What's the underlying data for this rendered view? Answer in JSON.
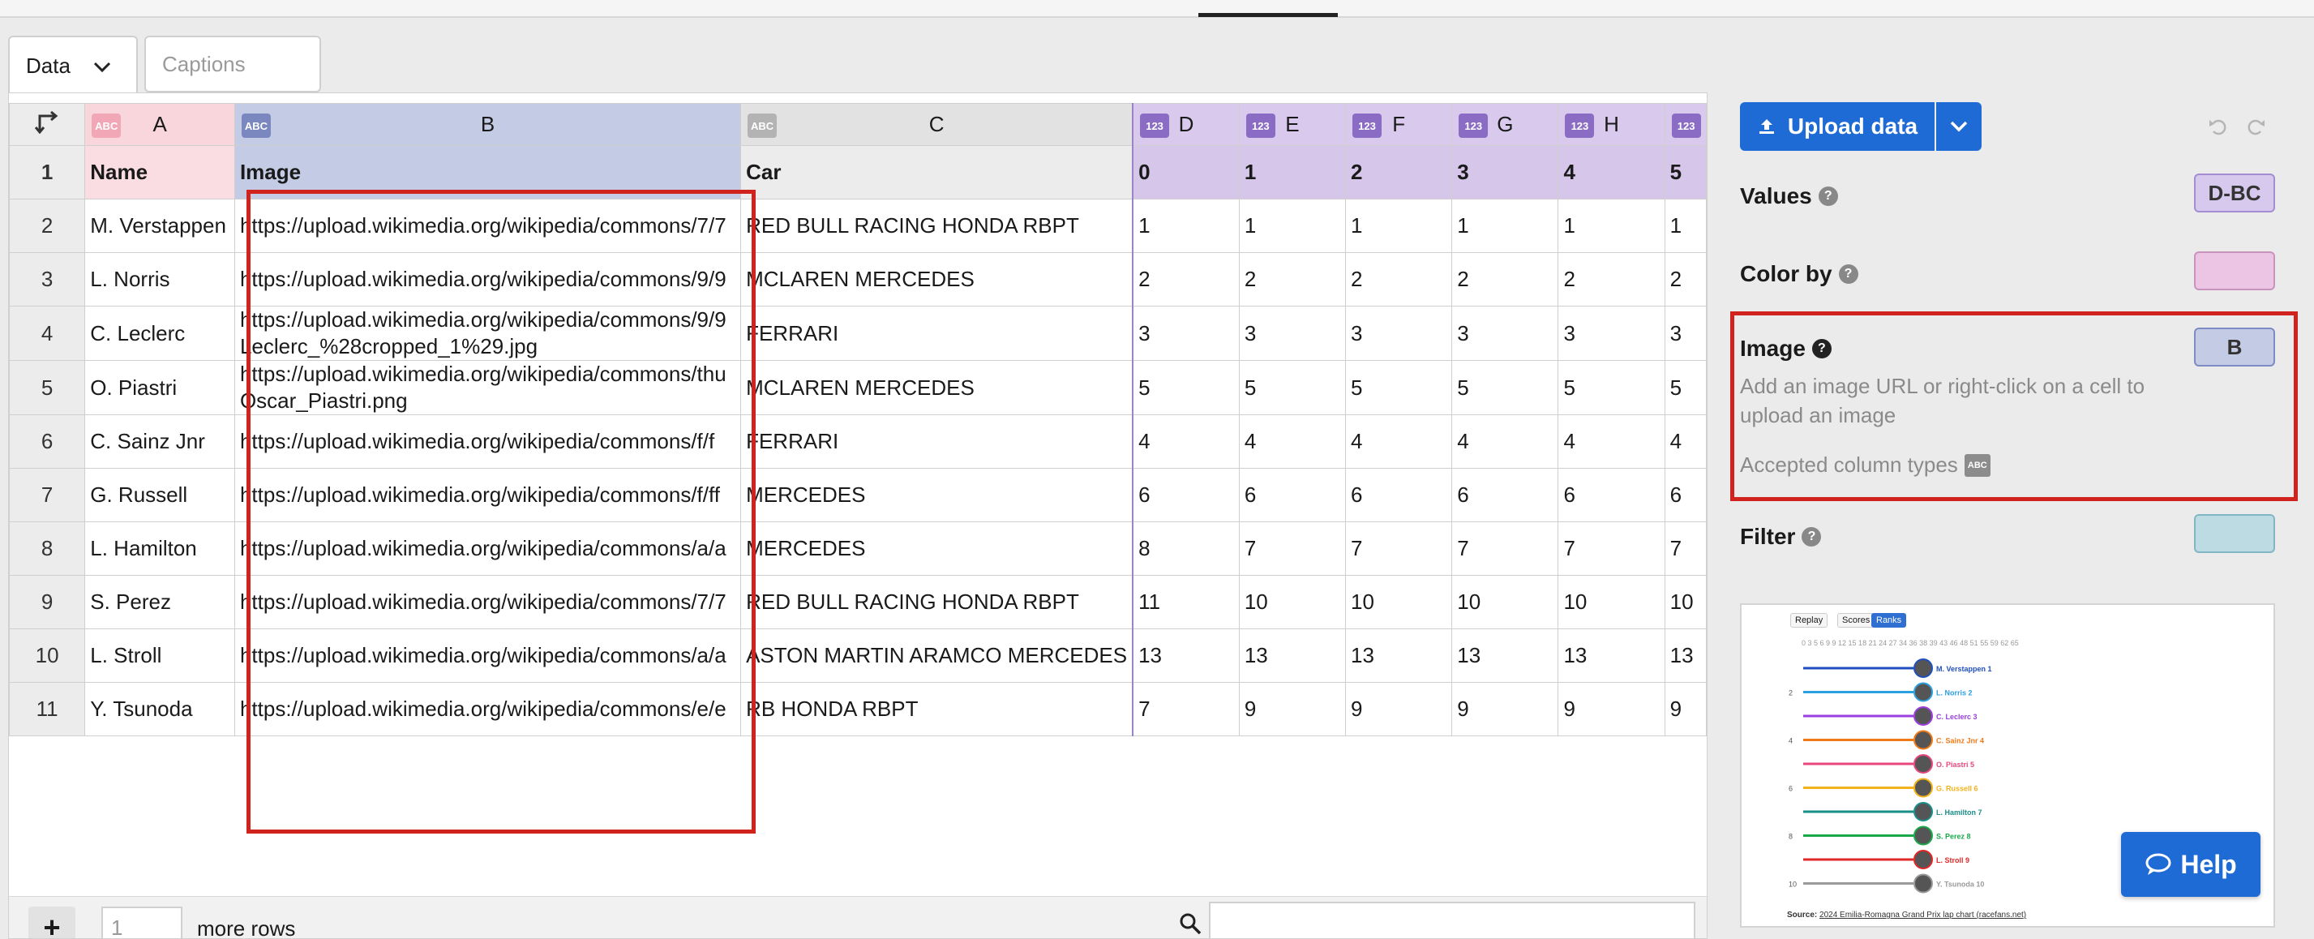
{
  "tabs": {
    "data": "Data",
    "captions": "Captions"
  },
  "grid": {
    "columns": [
      {
        "letter": "A",
        "type": "ABC"
      },
      {
        "letter": "B",
        "type": "ABC"
      },
      {
        "letter": "C",
        "type": "ABC"
      },
      {
        "letter": "D",
        "type": "123"
      },
      {
        "letter": "E",
        "type": "123"
      },
      {
        "letter": "F",
        "type": "123"
      },
      {
        "letter": "G",
        "type": "123"
      },
      {
        "letter": "H",
        "type": "123"
      },
      {
        "letter": "",
        "type": "123"
      }
    ],
    "rows": [
      {
        "num": "1",
        "cells": [
          "Name",
          "Image",
          "Car",
          "0",
          "1",
          "2",
          "3",
          "4",
          "5"
        ]
      },
      {
        "num": "2",
        "cells": [
          "M. Verstappen",
          "https://upload.wikimedia.org/wikipedia/commons/7/7",
          "RED BULL RACING HONDA RBPT",
          "1",
          "1",
          "1",
          "1",
          "1",
          "1"
        ]
      },
      {
        "num": "3",
        "cells": [
          "L. Norris",
          "https://upload.wikimedia.org/wikipedia/commons/9/9",
          "MCLAREN MERCEDES",
          "2",
          "2",
          "2",
          "2",
          "2",
          "2"
        ]
      },
      {
        "num": "4",
        "cells": [
          "C. Leclerc",
          "https://upload.wikimedia.org/wikipedia/commons/9/9 Leclerc_%28cropped_1%29.jpg",
          "FERRARI",
          "3",
          "3",
          "3",
          "3",
          "3",
          "3"
        ]
      },
      {
        "num": "5",
        "cells": [
          "O. Piastri",
          "https://upload.wikimedia.org/wikipedia/commons/thu Oscar_Piastri.png",
          "MCLAREN MERCEDES",
          "5",
          "5",
          "5",
          "5",
          "5",
          "5"
        ]
      },
      {
        "num": "6",
        "cells": [
          "C. Sainz Jnr",
          "https://upload.wikimedia.org/wikipedia/commons/f/f",
          "FERRARI",
          "4",
          "4",
          "4",
          "4",
          "4",
          "4"
        ]
      },
      {
        "num": "7",
        "cells": [
          "G. Russell",
          "https://upload.wikimedia.org/wikipedia/commons/f/ff",
          "MERCEDES",
          "6",
          "6",
          "6",
          "6",
          "6",
          "6"
        ]
      },
      {
        "num": "8",
        "cells": [
          "L. Hamilton",
          "https://upload.wikimedia.org/wikipedia/commons/a/a",
          "MERCEDES",
          "8",
          "7",
          "7",
          "7",
          "7",
          "7"
        ]
      },
      {
        "num": "9",
        "cells": [
          "S. Perez",
          "https://upload.wikimedia.org/wikipedia/commons/7/7",
          "RED BULL RACING HONDA RBPT",
          "11",
          "10",
          "10",
          "10",
          "10",
          "10"
        ]
      },
      {
        "num": "10",
        "cells": [
          "L. Stroll",
          "https://upload.wikimedia.org/wikipedia/commons/a/a",
          "ASTON MARTIN ARAMCO MERCEDES",
          "13",
          "13",
          "13",
          "13",
          "13",
          "13"
        ]
      },
      {
        "num": "11",
        "cells": [
          "Y. Tsunoda",
          "https://upload.wikimedia.org/wikipedia/commons/e/e",
          "RB HONDA RBPT",
          "7",
          "9",
          "9",
          "9",
          "9",
          "9"
        ]
      }
    ],
    "more_rows_value": "1",
    "more_rows_label": "more rows",
    "add_button": "+"
  },
  "panel": {
    "upload_label": "Upload data",
    "values_label": "Values",
    "values_chip": "D-BC",
    "colorby_label": "Color by",
    "colorby_chip": "",
    "image_label": "Image",
    "image_chip": "B",
    "image_hint": "Add an image URL or right-click on a cell to upload an image",
    "accepted_label": "Accepted column types",
    "accepted_badge": "ABC",
    "filter_label": "Filter",
    "filter_chip": ""
  },
  "preview": {
    "buttons": [
      "Replay",
      "Scores",
      "Ranks"
    ],
    "axis_text": "0  3 5 6 9 9  12  15  18  21  24  27       34  36  38  39       43  46  48  51       55  59  62  65",
    "drivers": [
      {
        "label": "M. Verstappen 1",
        "color": "#1f4fbf",
        "tick": ""
      },
      {
        "label": "L. Norris 2",
        "color": "#2b9fe0",
        "tick": "2"
      },
      {
        "label": "C. Leclerc 3",
        "color": "#9b3fe0",
        "tick": ""
      },
      {
        "label": "C. Sainz Jnr 4",
        "color": "#f07a18",
        "tick": "4"
      },
      {
        "label": "O. Piastri 5",
        "color": "#e8487e",
        "tick": ""
      },
      {
        "label": "G. Russell 6",
        "color": "#f2b31a",
        "tick": "6"
      },
      {
        "label": "L. Hamilton 7",
        "color": "#1a8f8a",
        "tick": ""
      },
      {
        "label": "S. Perez 8",
        "color": "#1aa84a",
        "tick": "8"
      },
      {
        "label": "L. Stroll 9",
        "color": "#e02828",
        "tick": ""
      },
      {
        "label": "Y. Tsunoda 10",
        "color": "#9a9a9a",
        "tick": "10"
      }
    ],
    "source_prefix": "Source:",
    "source_link": "2024 Emilia-Romagna Grand Prix lap chart (racefans.net)"
  },
  "help_label": "Help",
  "colors": {
    "accent": "#1f6bd6",
    "highlight": "#d0231e"
  }
}
